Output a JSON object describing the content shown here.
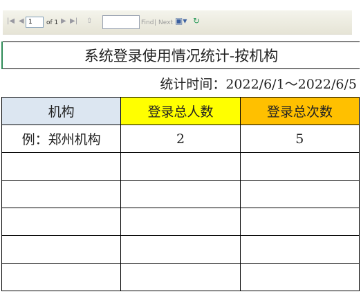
{
  "toolbar": {
    "first_icon": "first-page-icon",
    "prev_icon": "prev-page-icon",
    "page_value": "1",
    "page_of": "of 1",
    "next_icon": "next-page-icon",
    "last_icon": "last-page-icon",
    "back_icon": "back-icon",
    "find_value": "",
    "find_label": "Find",
    "separator": "|",
    "next_label": "Next",
    "export_icon": "save-export-icon",
    "refresh_icon": "refresh-icon"
  },
  "report": {
    "title": "系统登录使用情况统计-按机构",
    "period": "统计时间：2022/6/1～2022/6/5",
    "columns": [
      {
        "label": "机构",
        "bg": "#dce6f1"
      },
      {
        "label": "登录总人数",
        "bg": "#ffff00"
      },
      {
        "label": "登录总次数",
        "bg": "#ffc000"
      }
    ],
    "rows": [
      [
        "例：郑州机构",
        "2",
        "5"
      ],
      [
        "",
        "",
        ""
      ],
      [
        "",
        "",
        ""
      ],
      [
        "",
        "",
        ""
      ],
      [
        "",
        "",
        ""
      ],
      [
        "",
        "",
        ""
      ]
    ]
  }
}
